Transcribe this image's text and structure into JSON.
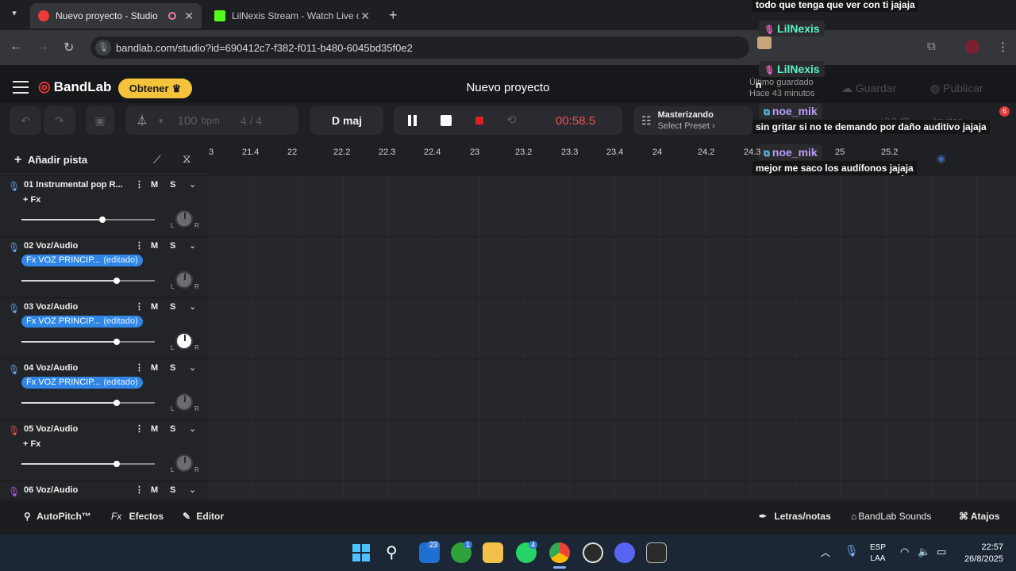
{
  "browser": {
    "tabs": [
      {
        "title": "Nuevo proyecto - Studio",
        "active": true,
        "color": "#f03a3a"
      },
      {
        "title": "LilNexis Stream - Watch Live on",
        "active": false,
        "color": "#53fc18"
      }
    ],
    "url": "bandlab.com/studio?id=690412c7-f382-f011-b480-6045bd35f0e2"
  },
  "app": {
    "logo": "BandLab",
    "get_button": "Obtener",
    "project_title": "Nuevo proyecto",
    "save_label": "Guardar",
    "publish_label": "Publicar",
    "invite_label": "Invitar",
    "saved_status": "Último guardado",
    "saved_time": "Hace 43 minutos",
    "db_readout": "+0.0 dB"
  },
  "toolbar": {
    "bpm_value": "100",
    "bpm_unit": "bpm",
    "time_signature": "4 / 4",
    "key": "D maj",
    "time": "00:58.5",
    "mastering_title": "Masterizando",
    "mastering_preset": "Select Preset",
    "add_track": "Añadir pista"
  },
  "ruler": {
    "ticks": [
      "3",
      "21.4",
      "22",
      "22.2",
      "22.3",
      "22.4",
      "23",
      "23.2",
      "23.3",
      "23.4",
      "24",
      "24.2",
      "24.3",
      "25",
      "25.2"
    ]
  },
  "tracks": [
    {
      "name": "01 Instrumental pop R...",
      "fx": "+ Fx",
      "fx_edited": false,
      "mic_color": "#6aa8f0"
    },
    {
      "name": "02 Voz/Audio",
      "fx": "Fx VOZ PRINCIP...",
      "fx_edited": true,
      "edited_label": "(editado)",
      "mic_color": "#6aa8f0"
    },
    {
      "name": "03 Voz/Audio",
      "fx": "Fx VOZ PRINCIP...",
      "fx_edited": true,
      "edited_label": "(editado)",
      "mic_color": "#6aa8f0"
    },
    {
      "name": "04 Voz/Audio",
      "fx": "Fx VOZ PRINCIP...",
      "fx_edited": true,
      "edited_label": "(editado)",
      "mic_color": "#6aa8f0"
    },
    {
      "name": "05 Voz/Audio",
      "fx": "+ Fx",
      "fx_edited": false,
      "mic_color": "#f04a4a"
    },
    {
      "name": "06 Voz/Audio",
      "fx": "",
      "fx_edited": false,
      "mic_color": "#b060f0"
    }
  ],
  "track_controls": {
    "mute": "M",
    "solo": "S",
    "left": "L",
    "right": "R"
  },
  "bottom": {
    "autopitch": "AutoPitch™",
    "effects": "Efectos",
    "editor": "Editor",
    "lyrics": "Letras/notas",
    "sounds": "BandLab Sounds",
    "shortcuts": "Atajos"
  },
  "chat": {
    "top_message": "todo que tenga que ver con ti jajaja",
    "user1": "LilNexis",
    "user2": "LilNexis",
    "user2_msg": "n",
    "user3": "noe_mik",
    "user3_msg": "sin gritar si no te demando por daño auditivo jajaja",
    "user4": "noe_mik",
    "user4_msg": "mejor me saco los audífonos jajaja",
    "notif_count": "6"
  },
  "taskbar": {
    "lang": "ESP",
    "layout": "LAA",
    "time": "22:57",
    "date": "26/8/2025",
    "badge_mail": "23",
    "badge_xbox": "1",
    "badge_whatsapp": "4"
  }
}
